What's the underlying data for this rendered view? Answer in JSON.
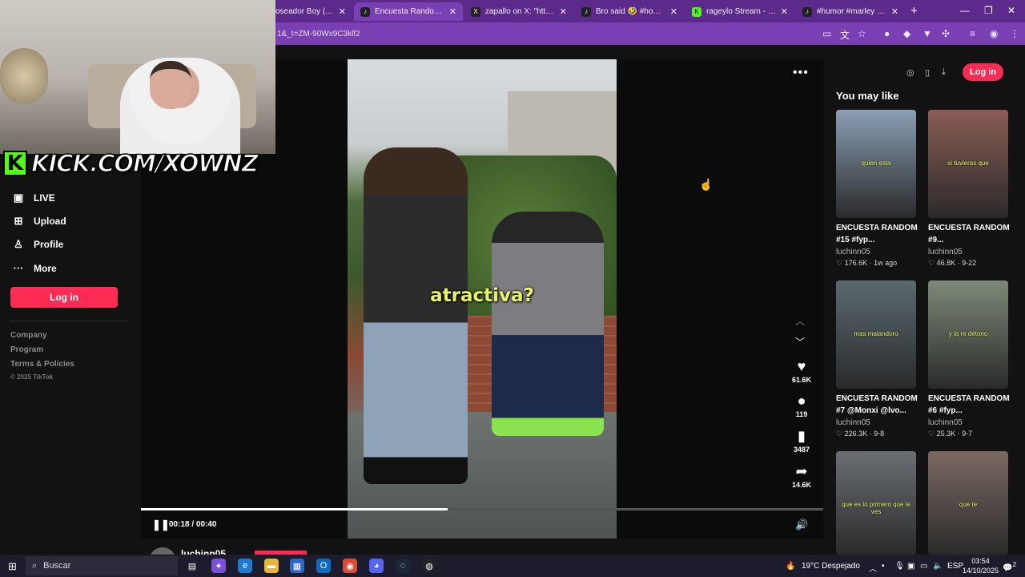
{
  "browser": {
    "tabs": [
      {
        "label": "oseador Boy (ft. Lol",
        "icon": "music-icon",
        "active": false
      },
      {
        "label": "Encuesta Random: M",
        "icon": "tiktok-icon",
        "active": true
      },
      {
        "label": "zapallo on X: \"https://t.co",
        "icon": "x-icon",
        "active": false
      },
      {
        "label": "Bro said 🤣 #hood #dab",
        "icon": "tiktok-icon",
        "active": false
      },
      {
        "label": "rageylo Stream - Watch L",
        "icon": "kick-icon",
        "active": false
      },
      {
        "label": "#humor #marley #viral #",
        "icon": "tiktok-icon",
        "active": false
      }
    ],
    "new_tab": "+",
    "url": "1&_t=ZM-90Wx9C3klf2"
  },
  "sidebar": {
    "items": [
      {
        "label": "LIVE",
        "icon": "live-icon",
        "glyph": "▣"
      },
      {
        "label": "Upload",
        "icon": "upload-icon",
        "glyph": "⊞"
      },
      {
        "label": "Profile",
        "icon": "profile-icon",
        "glyph": "♙"
      },
      {
        "label": "More",
        "icon": "more-icon",
        "glyph": "···"
      }
    ],
    "login": "Log in",
    "footer": [
      "Company",
      "Program",
      "Terms & Policies"
    ],
    "copyright": "© 2025 TikTok"
  },
  "video": {
    "caption": "atractiva?",
    "likes": "61.6K",
    "comments": "119",
    "saves": "3487",
    "shares": "14.6K",
    "current_time": "00:18",
    "duration": "00:40",
    "time_display": "00:18 / 00:40",
    "progress_fraction": 0.45,
    "author": "luchinn05"
  },
  "rail": {
    "login": "Log in",
    "title": "You may like",
    "cards": [
      {
        "thumb_caption": "quien esta",
        "title": "ENCUESTA RANDOM #15 #fyp...",
        "author": "luchinn05",
        "likes": "176.6K",
        "date": "1w ago",
        "bg": "#8aa0b5"
      },
      {
        "thumb_caption": "si tuvieras que",
        "title": "ENCUESTA RANDOM #9...",
        "author": "luchinn05",
        "likes": "46.8K",
        "date": "9-22",
        "bg": "#8a5d55"
      },
      {
        "thumb_caption": "mas malandoro",
        "title": "ENCUESTA RANDOM #7 @Monxi @lvo...",
        "author": "luchinn05",
        "likes": "226.3K",
        "date": "9-8",
        "bg": "#5a6a70"
      },
      {
        "thumb_caption": "y la re detono",
        "title": "ENCUESTA RANDOM #6 #fyp...",
        "author": "luchinn05",
        "likes": "25.3K",
        "date": "9-7",
        "bg": "#7d8a78"
      },
      {
        "thumb_caption": "que es lo primero que le ves",
        "title": "",
        "author": "",
        "likes": "",
        "date": "",
        "bg": "#6b6f74"
      },
      {
        "thumb_caption": "que te",
        "title": "",
        "author": "",
        "likes": "",
        "date": "",
        "bg": "#7a6a62"
      }
    ]
  },
  "overlay": {
    "kick_logo": "K",
    "kick_text": "KICK.COM/XOWNZ"
  },
  "taskbar": {
    "search": "Buscar",
    "weather": "19°C  Despejado",
    "lang": "ESP",
    "time": "03:54",
    "date": "14/10/2025",
    "notifications": "2"
  },
  "colors": {
    "brand_red": "#fe2c55",
    "tab_bar": "#5b2a8a",
    "kick_green": "#53fc18",
    "caption_yellow": "#e8f36a"
  }
}
